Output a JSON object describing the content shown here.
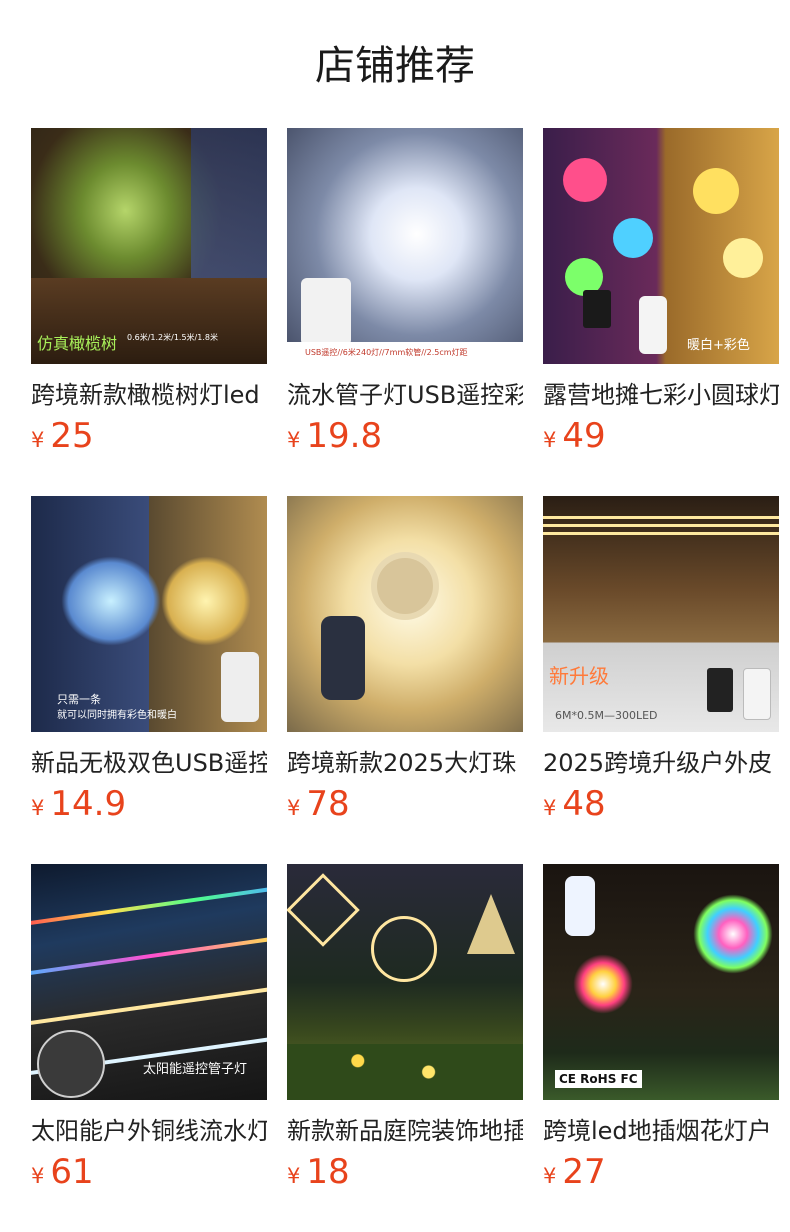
{
  "header": {
    "title": "店铺推荐"
  },
  "products": [
    {
      "name": "跨境新款橄榄树灯led",
      "currency": "¥",
      "price": "25",
      "caption": "仿真橄榄树",
      "subcaption": "0.6米/1.2米/1.5米/1.8米"
    },
    {
      "name": "流水管子灯USB遥控彩",
      "currency": "¥",
      "price": "19.8",
      "caption": "USB遥控//6米240灯//7mm软管//2.5cm灯距"
    },
    {
      "name": "露营地摊七彩小圆球灯",
      "currency": "¥",
      "price": "49",
      "caption": "暖白+彩色"
    },
    {
      "name": "新品无极双色USB遥控",
      "currency": "¥",
      "price": "14.9",
      "caption": "只需一条",
      "subcaption": "就可以同时拥有彩色和暖白"
    },
    {
      "name": "跨境新款2025大灯珠",
      "currency": "¥",
      "price": "78"
    },
    {
      "name": "2025跨境升级户外皮",
      "currency": "¥",
      "price": "48",
      "caption": "新升级",
      "subcaption": "6M*0.5M—300LED"
    },
    {
      "name": "太阳能户外铜线流水灯",
      "currency": "¥",
      "price": "61",
      "caption": "太阳能遥控管子灯"
    },
    {
      "name": "新款新品庭院装饰地插",
      "currency": "¥",
      "price": "18"
    },
    {
      "name": "跨境led地插烟花灯户",
      "currency": "¥",
      "price": "27",
      "caption": "CE RoHS FC"
    }
  ]
}
